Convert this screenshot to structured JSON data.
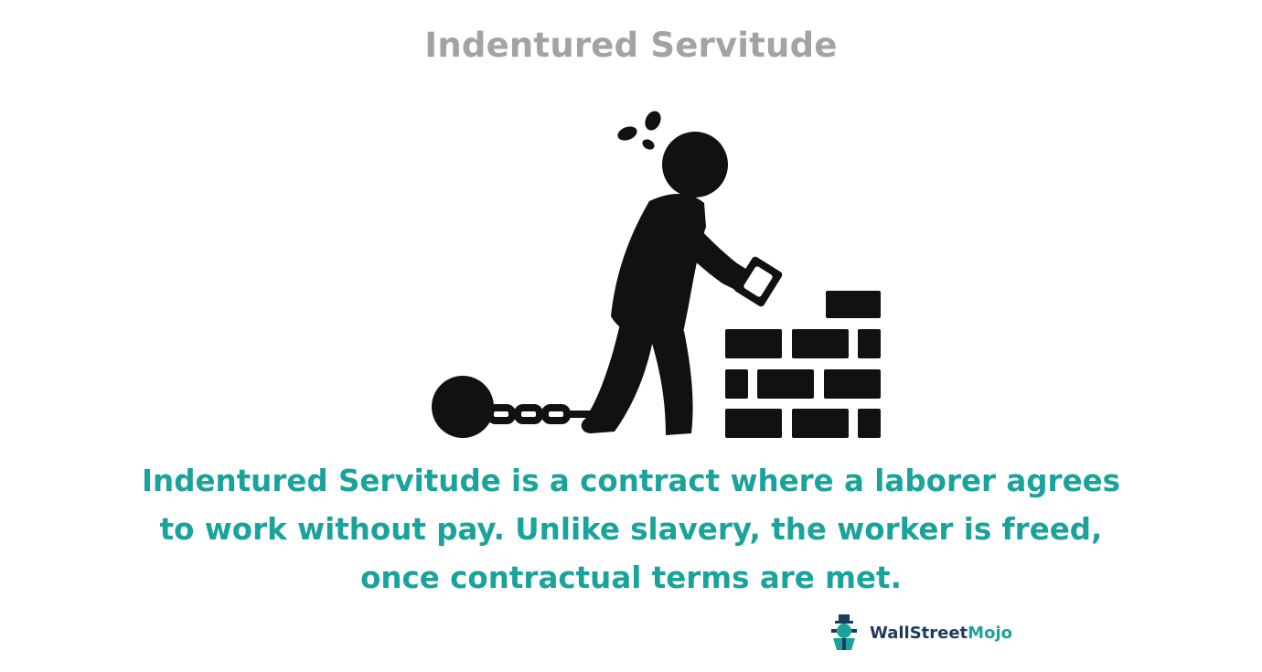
{
  "title": "Indentured Servitude",
  "illustration": {
    "icon": "laborer-chained-building-brick-wall-icon"
  },
  "definition": {
    "lines": [
      "Indentured Servitude is a contract where a laborer agrees",
      "to work without pay. Unlike slavery, the worker is freed,",
      "once contractual terms are met."
    ]
  },
  "brand": {
    "icon": "wallstreetmojo-logo-icon",
    "name_part1": "WallStreet",
    "name_part2": "Mojo"
  },
  "colors": {
    "title": "#a3a3a3",
    "definition_text": "#1aa39a",
    "brand_dark": "#1f3b5c",
    "brand_accent": "#1aa39a",
    "icon": "#111111"
  }
}
